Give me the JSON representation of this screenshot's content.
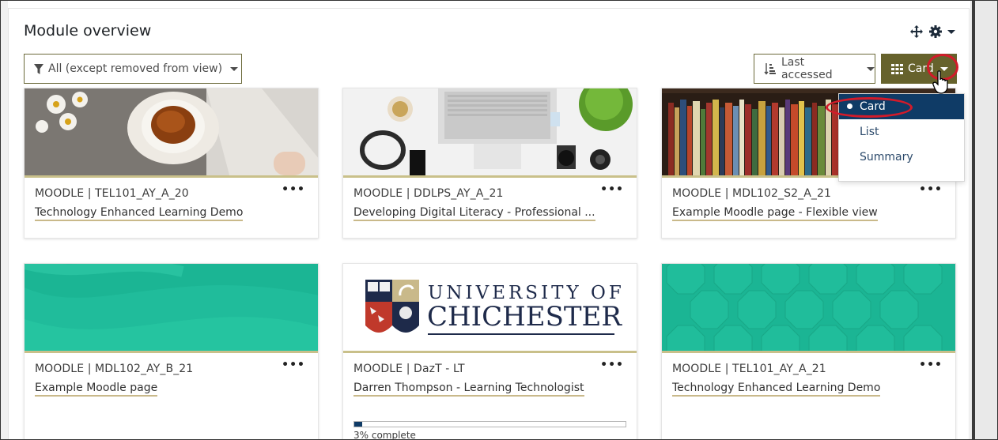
{
  "block": {
    "title": "Module overview",
    "filter_label": "All (except removed from view)",
    "sort_label": "Last accessed",
    "view_label": "Card"
  },
  "view_menu": {
    "items": [
      {
        "label": "Card",
        "active": true
      },
      {
        "label": "List",
        "active": false
      },
      {
        "label": "Summary",
        "active": false
      }
    ]
  },
  "courses": [
    {
      "category": "MOODLE | TEL101_AY_A_20",
      "title": "Technology Enhanced Learning Demo",
      "image": "tea-flowers-photo"
    },
    {
      "category": "MOODLE | DDLPS_AY_A_21",
      "title": "Developing Digital Literacy - Professional ...",
      "image": "desk-laptop-photo"
    },
    {
      "category": "MOODLE | MDL102_S2_A_21",
      "title": "Example Moodle page - Flexible view",
      "image": "bookshelf-photo"
    },
    {
      "category": "MOODLE | MDL102_AY_B_21",
      "title": "Example Moodle page",
      "image": "teal-waves-pattern"
    },
    {
      "category": "MOODLE | DazT - LT",
      "title": "Darren Thompson - Learning Technologist",
      "image": "university-logo",
      "progress": 3,
      "progress_text": "3% complete"
    },
    {
      "category": "MOODLE | TEL101_AY_A_21",
      "title": "Technology Enhanced Learning Demo",
      "image": "teal-octagon-pattern"
    }
  ],
  "logo": {
    "line1": "UNIVERSITY OF",
    "line2": "CHICHESTER"
  },
  "colors": {
    "accent": "#66622c",
    "active_item": "#0f3b66",
    "underline": "#c9b98a",
    "annotation": "#d21b2a"
  }
}
